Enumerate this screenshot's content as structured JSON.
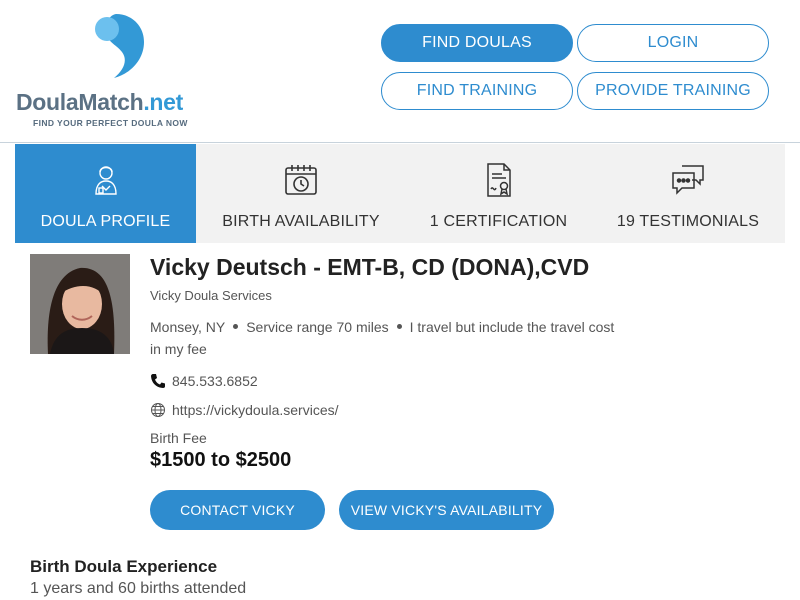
{
  "brand": {
    "name_part1": "Doula",
    "name_part2": "Match",
    "name_part3": ".net",
    "tagline": "FIND YOUR PERFECT DOULA NOW",
    "accent_color": "#2e8ccf"
  },
  "nav": {
    "find_doulas": "FIND DOULAS",
    "login": "LOGIN",
    "find_training": "FIND TRAINING",
    "provide_training": "PROVIDE TRAINING"
  },
  "tabs": [
    {
      "label": "DOULA PROFILE",
      "icon": "doula-profile-icon",
      "active": true
    },
    {
      "label": "BIRTH AVAILABILITY",
      "icon": "calendar-clock-icon",
      "active": false
    },
    {
      "label": "1 CERTIFICATION",
      "icon": "certificate-icon",
      "active": false
    },
    {
      "label": "19 TESTIMONIALS",
      "icon": "chat-bubbles-icon",
      "active": false
    }
  ],
  "profile": {
    "name": "Vicky Deutsch - EMT-B, CD (DONA),CVD",
    "business": "Vicky Doula Services",
    "city": "Monsey, NY",
    "service_range": "Service range 70 miles",
    "travel": "I travel but include the travel cost in my fee",
    "phone": "845.533.6852",
    "website": "https://vickydoula.services/",
    "fee_label": "Birth Fee",
    "fee_value": "$1500 to $2500",
    "contact_button": "CONTACT VICKY",
    "availability_button": "VIEW VICKY'S AVAILABILITY"
  },
  "experience": {
    "title": "Birth Doula Experience",
    "text": "1 years and 60 births attended"
  }
}
